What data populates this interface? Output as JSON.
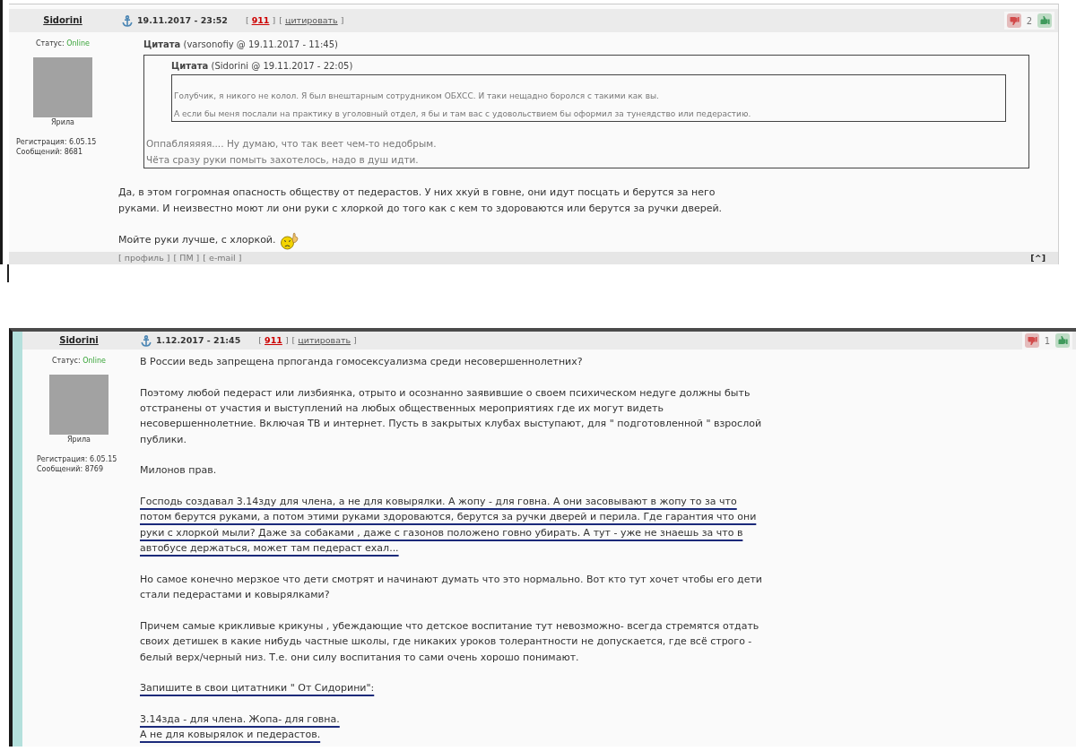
{
  "posts": [
    {
      "author": "Sidorini",
      "status_label": "Статус:",
      "status": "Online",
      "avatar_caption": "Ярила",
      "registration": "Регистрация: 6.05.15",
      "message_count": "Сообщений: 8681",
      "date": "19.11.2017 - 23:52",
      "header_links": [
        {
          "kind": "number",
          "open": "[",
          "label": "911",
          "close": "]"
        },
        {
          "kind": "quote",
          "open": "[",
          "label": "цитировать",
          "close": "]"
        }
      ],
      "rating": "2",
      "quotes": [
        {
          "header": "**Цитата** (varsonofiy @ 19.11.2017 - 11:45)",
          "quotes": [
            {
              "header": "**Цитата** (Sidorini @ 19.11.2017 - 22:05)",
              "paragraphs": [
                {
                  "lines": [
                    "Голубчик, я никого не колол. Я был внештарным сотрудником ОБХСС. И таки нещадно боролся с такими как вы."
                  ]
                },
                {
                  "lines": [
                    "А если бы меня послали на практику в уголовный отдел, я бы и там вас с удовольствием бы оформил за тунеядство или педерастию."
                  ]
                }
              ]
            }
          ],
          "paragraphs": [
            {
              "lines": [
                "Оппабляяяяя.... Ну думаю, что так веет чем-то недобрым.",
                "Чёта сразу руки помыть захотелось, надо в душ идти."
              ]
            }
          ]
        }
      ],
      "paragraphs": [
        {
          "lines": [
            "Да, в этом гогромная опасность обществу от педерастов. У них хкуй в говне, они идут посцать и берутся за него",
            "руками. И неизвестно моют ли они руки с хлоркой до того как с кем то здороваются или берутся за ручки дверей."
          ],
          "underlined": false
        },
        {
          "lines": [
            "Мойте руки лучше, с хлоркой."
          ],
          "underlined": false,
          "smiley": true
        }
      ],
      "footer_links": [
        {
          "open": "[",
          "label": "профиль",
          "close": "]"
        },
        {
          "open": "[",
          "label": "ПМ",
          "close": "]"
        },
        {
          "open": "[",
          "label": "e-mail",
          "close": "]"
        }
      ],
      "top_link": "[^]"
    },
    {
      "author": "Sidorini",
      "status_label": "Статус:",
      "status": "Online",
      "avatar_caption": "Ярила",
      "registration": "Регистрация: 6.05.15",
      "message_count": "Сообщений: 8769",
      "date": "1.12.2017 - 21:45",
      "header_links": [
        {
          "kind": "number",
          "open": "[",
          "label": "911",
          "close": "]"
        },
        {
          "kind": "quote",
          "open": "[",
          "label": "цитировать",
          "close": "]"
        }
      ],
      "rating": "1",
      "paragraphs": [
        {
          "lines": [
            "В России ведь запрещена прпоганда гомосексуализма среди несовершеннолетних?"
          ],
          "underlined": false
        },
        {
          "lines": [
            "Поэтому любой педераст или лизбиянка, отрыто и осознанно заявившие о своем психическом недуге должны быть",
            "отстранены от участия и выступлений на любых общественных мероприятиях где их могут видеть",
            "несовершеннолетние. Включая ТВ и интернет. Пусть в закрытых клубах выступают, для \" подготовленной \" взрослой",
            "публики."
          ],
          "underlined": false
        },
        {
          "lines": [
            "Милонов прав."
          ],
          "underlined": false
        },
        {
          "lines": [
            "Господь создавал 3.14зду для члена, а не для ковырялки. А жопу - для говна. А они засовывают в жопу то за что",
            "потом берутся руками, а потом этими руками здороваются, берутся за ручки дверей и перила. Где гарантия что они",
            "руки с хлоркой мыли? Даже за собаками , даже с газонов положено говно убирать. А тут - уже не знаешь за что в",
            "автобусе держаться, может там педераст ехал..."
          ],
          "underlined": true
        },
        {
          "lines": [
            "Но самое конечно мерзкое что дети смотрят и начинают думать что это нормально. Вот кто тут хочет чтобы его дети",
            "стали педерастами и ковырялками?"
          ],
          "underlined": false
        },
        {
          "lines": [
            "Причем самые крикливые крикуны , убеждающие что детское воспитание тут невозможно- всегда стремятся отдать",
            "своих детишек в какие нибудь частные школы, где никаких уроков толерантности не допускается, где всё строго -",
            "белый верх/черный низ. Т.е. они силу воспитания то сами очень хорошо понимают."
          ],
          "underlined": false
        },
        {
          "lines": [
            "Запишите в свои цитатники \" От Сидорини\":"
          ],
          "underlined": true
        },
        {
          "lines": [
            "3.14зда - для члена. Жопа- для говна.",
            "А не для ковырялок и педерастов."
          ],
          "underlined": true
        }
      ]
    }
  ]
}
